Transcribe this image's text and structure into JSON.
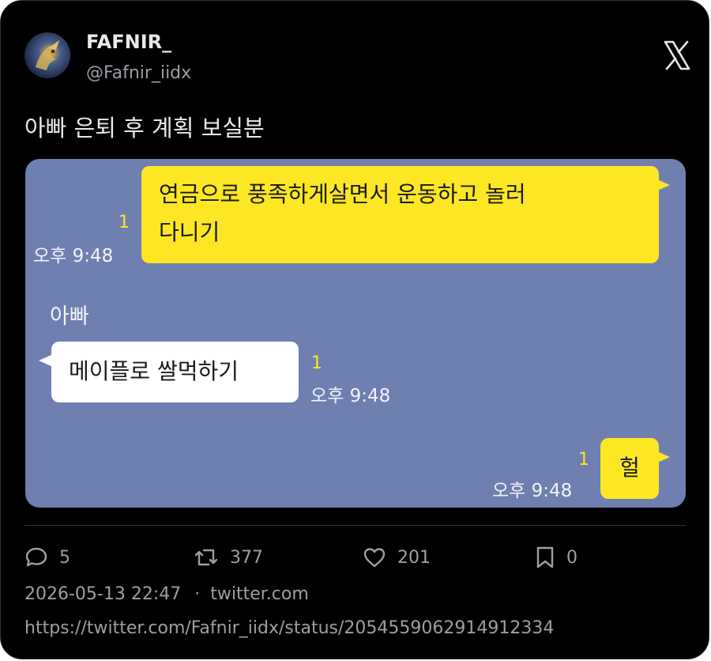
{
  "author": {
    "name": "FAFNIR_",
    "handle": "@Fafnir_iidx",
    "avatar_icon": "dragon-avatar"
  },
  "platform_logo": "x-logo-icon",
  "tweet_text": "아빠 은퇴 후 계획 보실분",
  "chat": {
    "background": "#6e7fb0",
    "my_bubble_color": "#fde724",
    "messages": [
      {
        "line1": "연금으로 풍족하게살면서 운동하고 놀러",
        "line2": "다니기",
        "unread": "1",
        "time": "오후 9:48"
      },
      {
        "sender": "아빠",
        "text": "메이플로 쌀먹하기",
        "unread": "1",
        "time": "오후 9:48"
      },
      {
        "text": "헐",
        "unread": "1",
        "time": "오후 9:48"
      }
    ]
  },
  "actions": {
    "replies": "5",
    "retweets": "377",
    "likes": "201",
    "bookmarks": "0"
  },
  "meta": {
    "datetime": "2026-05-13 22:47",
    "separator": "·",
    "source": "twitter.com"
  },
  "url": "https://twitter.com/Fafnir_iidx/status/2054559062914912334"
}
